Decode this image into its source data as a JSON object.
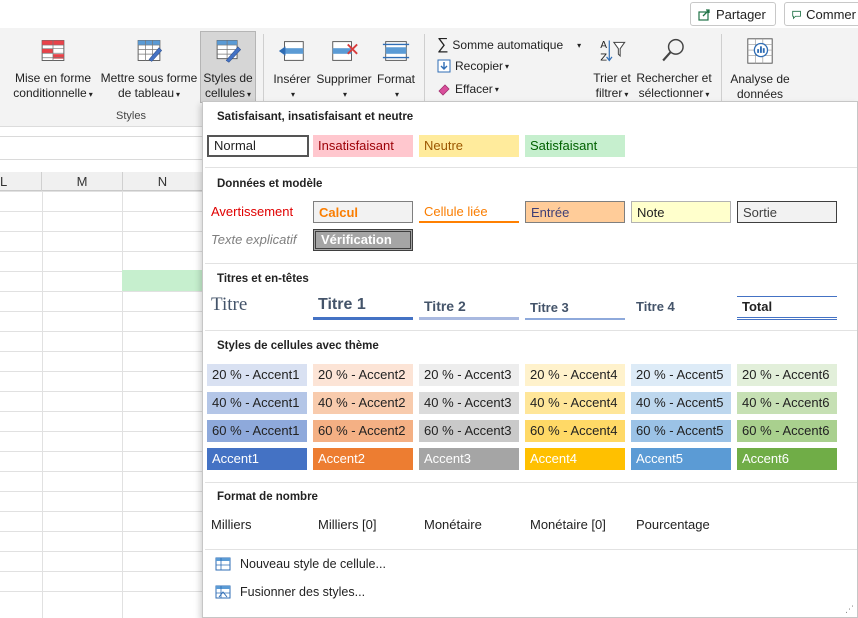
{
  "top_buttons": {
    "share": "Partager",
    "comments": "Commer"
  },
  "ribbon": {
    "conditional": [
      "Mise en forme",
      "conditionnelle"
    ],
    "table": [
      "Mettre sous forme",
      "de tableau"
    ],
    "cell_styles": [
      "Styles de",
      "cellules"
    ],
    "group_styles": "Styles",
    "insert": "Insérer",
    "delete": "Supprimer",
    "format": "Format",
    "autosum": "Somme automatique",
    "fill": "Recopier",
    "clear": "Effacer",
    "sort": [
      "Trier et",
      "filtrer"
    ],
    "find": [
      "Rechercher et",
      "sélectionner"
    ],
    "analyze": [
      "Analyse de",
      "données"
    ]
  },
  "columns": [
    "L",
    "M",
    "N"
  ],
  "styles_menu": {
    "sections": [
      "Satisfaisant, insatisfaisant et neutre",
      "Données et modèle",
      "Titres et en-têtes",
      "Styles de cellules avec thème",
      "Format de nombre"
    ],
    "good_bad": [
      "Normal",
      "Insatisfaisant",
      "Neutre",
      "Satisfaisant"
    ],
    "data_model_row1": [
      "Avertissement",
      "Calcul",
      "Cellule liée",
      "Entrée",
      "Note",
      "Sortie"
    ],
    "data_model_row2": [
      "Texte explicatif",
      "Vérification"
    ],
    "titles": [
      "Titre",
      "Titre 1",
      "Titre 2",
      "Titre 3",
      "Titre 4",
      "Total"
    ],
    "theme_rows": [
      [
        "20 % - Accent1",
        "20 % - Accent2",
        "20 % - Accent3",
        "20 % - Accent4",
        "20 % - Accent5",
        "20 % - Accent6"
      ],
      [
        "40 % - Accent1",
        "40 % - Accent2",
        "40 % - Accent3",
        "40 % - Accent4",
        "40 % - Accent5",
        "40 % - Accent6"
      ],
      [
        "60 % - Accent1",
        "60 % - Accent2",
        "60 % - Accent3",
        "60 % - Accent4",
        "60 % - Accent5",
        "60 % - Accent6"
      ],
      [
        "Accent1",
        "Accent2",
        "Accent3",
        "Accent4",
        "Accent5",
        "Accent6"
      ]
    ],
    "number_formats": [
      "Milliers",
      "Milliers [0]",
      "Monétaire",
      "Monétaire [0]",
      "Pourcentage"
    ],
    "menu_items": [
      "Nouveau style de cellule...",
      "Fusionner des styles..."
    ]
  },
  "colors": {
    "accent1": "#4472c4",
    "accent2": "#ed7d31",
    "accent3": "#a5a5a5",
    "accent4": "#ffc000",
    "accent5": "#5b9bd5",
    "accent6": "#70ad47",
    "good_fill": "#c6efce",
    "bad_fill": "#ffc7ce",
    "neutral_fill": "#ffeb9c"
  }
}
